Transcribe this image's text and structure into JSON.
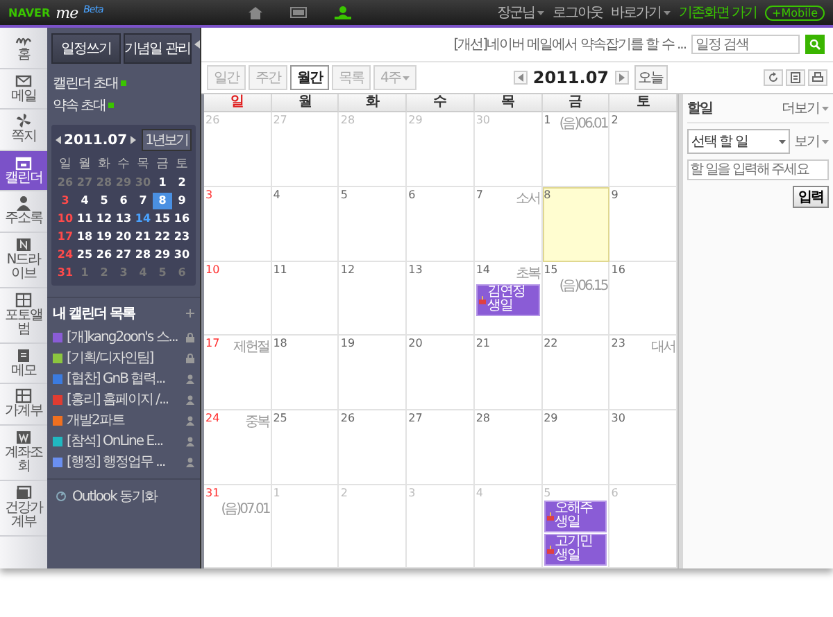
{
  "top_bar": {
    "logo": "NAVER",
    "brand": "me",
    "badge": "Beta",
    "nav": [
      {
        "selected": false
      },
      {
        "selected": false
      },
      {
        "selected": true
      }
    ],
    "links": [
      {
        "label": "장군님",
        "kind": "menu"
      },
      {
        "label": "로그아웃",
        "kind": "link"
      },
      {
        "label": "바로가기",
        "kind": "menu"
      },
      {
        "label": "기존화면 가기",
        "kind": "highlight"
      },
      {
        "label": "+Mobile",
        "kind": "pill"
      }
    ]
  },
  "rail": [
    {
      "label": "홈",
      "selected": false
    },
    {
      "label": "메일",
      "selected": false
    },
    {
      "label": "쪽지",
      "selected": false
    },
    {
      "label": "캘린더",
      "selected": true
    },
    {
      "label": "주소록",
      "selected": false
    },
    {
      "label": "N드라이브",
      "selected": false
    },
    {
      "label": "포토앨범",
      "selected": false
    },
    {
      "label": "메모",
      "selected": false
    },
    {
      "label": "가계부",
      "selected": false
    },
    {
      "label": "계좌조회",
      "selected": false
    },
    {
      "label": "건강가계부",
      "selected": false
    }
  ],
  "sidebar": {
    "buttons": [
      "일정쓰기",
      "기념일 관리"
    ],
    "invites": [
      "캘린더 초대",
      "약속 초대"
    ],
    "mini_calendar": {
      "month": "2011.07",
      "year_button": "1년보기",
      "weekdays": [
        "일",
        "월",
        "화",
        "수",
        "목",
        "금",
        "토"
      ],
      "weeks": [
        [
          {
            "day": "26",
            "other_month": true,
            "selected": false,
            "marked": false
          },
          {
            "day": "27",
            "other_month": true,
            "selected": false,
            "marked": false
          },
          {
            "day": "28",
            "other_month": true,
            "selected": false,
            "marked": false
          },
          {
            "day": "29",
            "other_month": true,
            "selected": false,
            "marked": false
          },
          {
            "day": "30",
            "other_month": true,
            "selected": false,
            "marked": false
          },
          {
            "day": "1",
            "other_month": false,
            "selected": false,
            "marked": false
          },
          {
            "day": "2",
            "other_month": false,
            "selected": false,
            "marked": false
          }
        ],
        [
          {
            "day": "3",
            "other_month": false,
            "selected": false,
            "marked": false
          },
          {
            "day": "4",
            "other_month": false,
            "selected": false,
            "marked": false
          },
          {
            "day": "5",
            "other_month": false,
            "selected": false,
            "marked": false
          },
          {
            "day": "6",
            "other_month": false,
            "selected": false,
            "marked": false
          },
          {
            "day": "7",
            "other_month": false,
            "selected": false,
            "marked": false
          },
          {
            "day": "8",
            "other_month": false,
            "selected": true,
            "marked": false
          },
          {
            "day": "9",
            "other_month": false,
            "selected": false,
            "marked": false
          }
        ],
        [
          {
            "day": "10",
            "other_month": false,
            "selected": false,
            "marked": false
          },
          {
            "day": "11",
            "other_month": false,
            "selected": false,
            "marked": false
          },
          {
            "day": "12",
            "other_month": false,
            "selected": false,
            "marked": false
          },
          {
            "day": "13",
            "other_month": false,
            "selected": false,
            "marked": false
          },
          {
            "day": "14",
            "other_month": false,
            "selected": false,
            "marked": true
          },
          {
            "day": "15",
            "other_month": false,
            "selected": false,
            "marked": false
          },
          {
            "day": "16",
            "other_month": false,
            "selected": false,
            "marked": false
          }
        ],
        [
          {
            "day": "17",
            "other_month": false,
            "selected": false,
            "marked": false
          },
          {
            "day": "18",
            "other_month": false,
            "selected": false,
            "marked": false
          },
          {
            "day": "19",
            "other_month": false,
            "selected": false,
            "marked": false
          },
          {
            "day": "20",
            "other_month": false,
            "selected": false,
            "marked": false
          },
          {
            "day": "21",
            "other_month": false,
            "selected": false,
            "marked": false
          },
          {
            "day": "22",
            "other_month": false,
            "selected": false,
            "marked": false
          },
          {
            "day": "23",
            "other_month": false,
            "selected": false,
            "marked": false
          }
        ],
        [
          {
            "day": "24",
            "other_month": false,
            "selected": false,
            "marked": false
          },
          {
            "day": "25",
            "other_month": false,
            "selected": false,
            "marked": false
          },
          {
            "day": "26",
            "other_month": false,
            "selected": false,
            "marked": false
          },
          {
            "day": "27",
            "other_month": false,
            "selected": false,
            "marked": false
          },
          {
            "day": "28",
            "other_month": false,
            "selected": false,
            "marked": false
          },
          {
            "day": "29",
            "other_month": false,
            "selected": false,
            "marked": false
          },
          {
            "day": "30",
            "other_month": false,
            "selected": false,
            "marked": false
          }
        ],
        [
          {
            "day": "31",
            "other_month": false,
            "selected": false,
            "marked": false
          },
          {
            "day": "1",
            "other_month": true,
            "selected": false,
            "marked": false
          },
          {
            "day": "2",
            "other_month": true,
            "selected": false,
            "marked": false
          },
          {
            "day": "3",
            "other_month": true,
            "selected": false,
            "marked": false
          },
          {
            "day": "4",
            "other_month": true,
            "selected": false,
            "marked": false
          },
          {
            "day": "5",
            "other_month": true,
            "selected": false,
            "marked": false
          },
          {
            "day": "6",
            "other_month": true,
            "selected": false,
            "marked": false
          }
        ]
      ]
    },
    "calendar_list": {
      "title": "내 캘린더 목록",
      "items": [
        {
          "name": "[개]kang2oon's 스...",
          "color": "#8a5cd6",
          "kind": "private"
        },
        {
          "name": "[기획/디자인팀]",
          "color": "#8cc63f",
          "kind": "private"
        },
        {
          "name": "[협찬] GnB 협력...",
          "color": "#3b7be0",
          "kind": "shared"
        },
        {
          "name": "[홍리] 홈페이지 /...",
          "color": "#e03c31",
          "kind": "shared"
        },
        {
          "name": "개발2파트",
          "color": "#f07020",
          "kind": "shared"
        },
        {
          "name": "[참석] OnLine E...",
          "color": "#20b8c0",
          "kind": "shared"
        },
        {
          "name": "[행정] 행정업무 ...",
          "color": "#6a8ff0",
          "kind": "shared"
        }
      ]
    },
    "sync": "Outlook 동기화"
  },
  "main": {
    "notice": "[개선]네이버 메일에서 약속잡기를 할 수 ...",
    "search": {
      "placeholder": "일정 검색"
    },
    "views": [
      {
        "label": "일간",
        "selected": false,
        "kind": "tab"
      },
      {
        "label": "주간",
        "selected": false,
        "kind": "tab"
      },
      {
        "label": "월간",
        "selected": true,
        "kind": "tab"
      },
      {
        "label": "목록",
        "selected": false,
        "kind": "tab"
      },
      {
        "label": "4주",
        "selected": false,
        "kind": "dropdown"
      }
    ],
    "month": "2011.07",
    "today_button": "오늘",
    "weekdays": [
      "일",
      "월",
      "화",
      "수",
      "목",
      "금",
      "토"
    ],
    "weeks": [
      [
        {
          "day": "26",
          "other_month": true,
          "selected": false
        },
        {
          "day": "27",
          "other_month": true,
          "selected": false
        },
        {
          "day": "28",
          "other_month": true,
          "selected": false
        },
        {
          "day": "29",
          "other_month": true,
          "selected": false
        },
        {
          "day": "30",
          "other_month": true,
          "selected": false
        },
        {
          "day": "1",
          "other_month": false,
          "selected": false,
          "note": "(음)06.01"
        },
        {
          "day": "2",
          "other_month": false,
          "selected": false
        }
      ],
      [
        {
          "day": "3",
          "other_month": false,
          "selected": false
        },
        {
          "day": "4",
          "other_month": false,
          "selected": false
        },
        {
          "day": "5",
          "other_month": false,
          "selected": false
        },
        {
          "day": "6",
          "other_month": false,
          "selected": false
        },
        {
          "day": "7",
          "other_month": false,
          "selected": false,
          "note": "소서"
        },
        {
          "day": "8",
          "other_month": false,
          "selected": true
        },
        {
          "day": "9",
          "other_month": false,
          "selected": false
        }
      ],
      [
        {
          "day": "10",
          "other_month": false,
          "selected": false
        },
        {
          "day": "11",
          "other_month": false,
          "selected": false
        },
        {
          "day": "12",
          "other_month": false,
          "selected": false
        },
        {
          "day": "13",
          "other_month": false,
          "selected": false
        },
        {
          "day": "14",
          "other_month": false,
          "selected": false,
          "note": "초복",
          "events": [
            {
              "title": "김연정 생일"
            }
          ]
        },
        {
          "day": "15",
          "other_month": false,
          "selected": false,
          "note": "(음)06.15"
        },
        {
          "day": "16",
          "other_month": false,
          "selected": false
        }
      ],
      [
        {
          "day": "17",
          "other_month": false,
          "selected": false,
          "note": "제헌절"
        },
        {
          "day": "18",
          "other_month": false,
          "selected": false
        },
        {
          "day": "19",
          "other_month": false,
          "selected": false
        },
        {
          "day": "20",
          "other_month": false,
          "selected": false
        },
        {
          "day": "21",
          "other_month": false,
          "selected": false
        },
        {
          "day": "22",
          "other_month": false,
          "selected": false
        },
        {
          "day": "23",
          "other_month": false,
          "selected": false,
          "note": "대서"
        }
      ],
      [
        {
          "day": "24",
          "other_month": false,
          "selected": false,
          "note": "중복"
        },
        {
          "day": "25",
          "other_month": false,
          "selected": false
        },
        {
          "day": "26",
          "other_month": false,
          "selected": false
        },
        {
          "day": "27",
          "other_month": false,
          "selected": false
        },
        {
          "day": "28",
          "other_month": false,
          "selected": false
        },
        {
          "day": "29",
          "other_month": false,
          "selected": false
        },
        {
          "day": "30",
          "other_month": false,
          "selected": false
        }
      ],
      [
        {
          "day": "31",
          "other_month": false,
          "selected": false,
          "note": "(음)07.01"
        },
        {
          "day": "1",
          "other_month": true,
          "selected": false
        },
        {
          "day": "2",
          "other_month": true,
          "selected": false
        },
        {
          "day": "3",
          "other_month": true,
          "selected": false
        },
        {
          "day": "4",
          "other_month": true,
          "selected": false
        },
        {
          "day": "5",
          "other_month": true,
          "selected": false,
          "events": [
            {
              "title": "오해주 생일"
            },
            {
              "title": "고기민 생일"
            }
          ]
        },
        {
          "day": "6",
          "other_month": true,
          "selected": false
        }
      ]
    ]
  },
  "todo": {
    "title": "할일",
    "more": "더보기",
    "filter": "선택 할 일",
    "view": "보기",
    "input": {
      "placeholder": "할 일을 입력해 주세요"
    },
    "submit": "입력"
  }
}
